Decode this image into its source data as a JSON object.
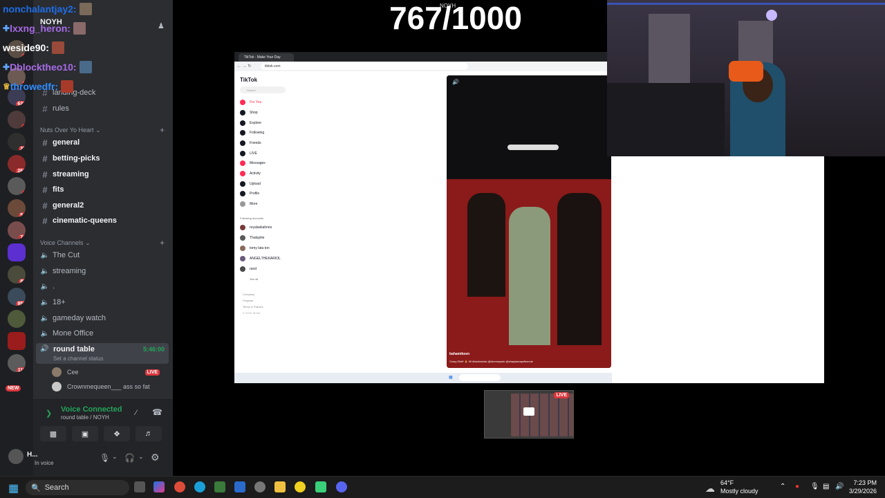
{
  "overlay": {
    "counter": "767/1000",
    "counter_small": "NOYH",
    "chat": [
      {
        "name": "nonchalantjay2:",
        "color": "#1e6ee8"
      },
      {
        "name": "lxxng_heron:",
        "color": "#a86be8"
      },
      {
        "name": "weside90:",
        "color": "#ffffff"
      },
      {
        "name": "Dblocktheo10:",
        "color": "#a86be8"
      },
      {
        "name": "throwedfr:",
        "color": "#2f8cff"
      }
    ]
  },
  "server_badges": [
    "1",
    "9",
    "620",
    "4",
    "25",
    "261",
    "4",
    "54",
    "71",
    "85",
    "958",
    "118"
  ],
  "server_new": "NEW",
  "sidebar": {
    "server_name": "NOYH",
    "top_channels": [
      {
        "label": "landing-deck"
      },
      {
        "label": "rules"
      }
    ],
    "cat_text": {
      "title": "Nuts Over Yo Heart",
      "channels": [
        {
          "label": "general"
        },
        {
          "label": "betting-picks"
        },
        {
          "label": "streaming"
        },
        {
          "label": "fits"
        },
        {
          "label": "general2"
        },
        {
          "label": "cinematic-queens"
        }
      ]
    },
    "cat_voice": {
      "title": "Voice Channels",
      "channels": [
        {
          "label": "The Cut"
        },
        {
          "label": "streaming"
        },
        {
          "label": "."
        },
        {
          "label": "18+"
        },
        {
          "label": "gameday watch"
        },
        {
          "label": "Mone Office"
        }
      ]
    },
    "round_table": {
      "label": "round table",
      "timer": "5:46:00",
      "status": "Set a channel status"
    },
    "members": [
      {
        "name": "Cee",
        "live": "LIVE"
      },
      {
        "name": "Crownmequeen___ ass so fat",
        "live": ""
      }
    ],
    "voice": {
      "status": "Voice Connected",
      "location": "round table / NOYH"
    },
    "user": {
      "name": "H...",
      "status": "In voice"
    }
  },
  "browser": {
    "tab_title": "TikTok - Make Your Day",
    "url": "tiktok.com",
    "tiktok": {
      "logo": "TikTok",
      "search_placeholder": "Search",
      "nav": [
        "For You",
        "Shop",
        "Explore",
        "Following",
        "Friends",
        "LIVE",
        "Messages",
        "Activity",
        "Upload",
        "Profile",
        "More"
      ],
      "following_title": "Following accounts",
      "following": [
        "reyalaskahnes",
        "Thatsjolie",
        "tomy lata ton",
        "ANGELTHEKARIOL",
        "rand"
      ],
      "see_all": "See all",
      "footer": [
        "Company",
        "Program",
        "Terms & Policies",
        "© 2026 TikTok"
      ]
    },
    "video_caption_user": "bahamikoen",
    "video_caption": "Crazy 50off 🙏 99 #fashionista @drummyseb @shaylashayelbonnie"
  },
  "mini_live": "LIVE",
  "taskbar": {
    "search": "Search",
    "weather_temp": "64°F",
    "weather_desc": "Mostly cloudy",
    "time": "7:23 PM",
    "date": "3/29/2026"
  }
}
